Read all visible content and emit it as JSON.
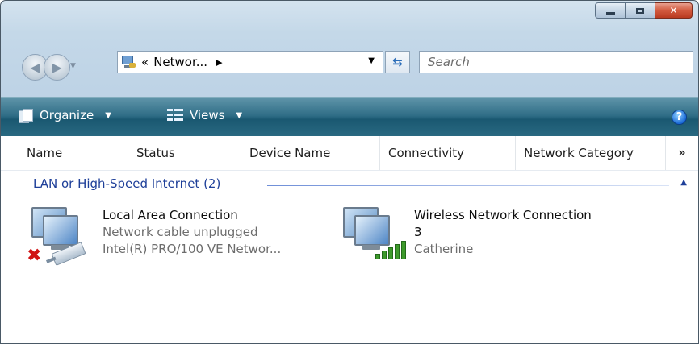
{
  "window": {
    "caption_buttons": {
      "minimize": "minimize",
      "maximize": "maximize",
      "close": "✕"
    }
  },
  "nav": {
    "address_text": "Networ...",
    "address_prefix": "«",
    "address_sep": "▶",
    "address_drop": "▼",
    "refresh": "⇆",
    "search_placeholder": "Search"
  },
  "toolbar": {
    "organize_label": "Organize",
    "views_label": "Views",
    "arrow": "▼",
    "help": "?"
  },
  "columns": [
    "Name",
    "Status",
    "Device Name",
    "Connectivity",
    "Network Category"
  ],
  "columns_more": "»",
  "group": {
    "label": "LAN or High-Speed Internet (2)",
    "toggle": "▲"
  },
  "items": [
    {
      "title": "Local Area Connection",
      "status": "Network cable unplugged",
      "device": "Intel(R) PRO/100 VE Networ..."
    },
    {
      "title_line1": "Wireless Network Connection",
      "title_line2": "3",
      "network": "Catherine"
    }
  ],
  "colors": {
    "toolbar_dark": "#1a5871",
    "group_text": "#1e3f99",
    "close_red": "#d25a3f"
  },
  "icons": [
    "back-icon",
    "forward-icon",
    "network-folder-icon",
    "refresh-icon",
    "organize-icon",
    "views-icon",
    "help-icon",
    "network-disconnected-icon",
    "wireless-signal-icon"
  ]
}
